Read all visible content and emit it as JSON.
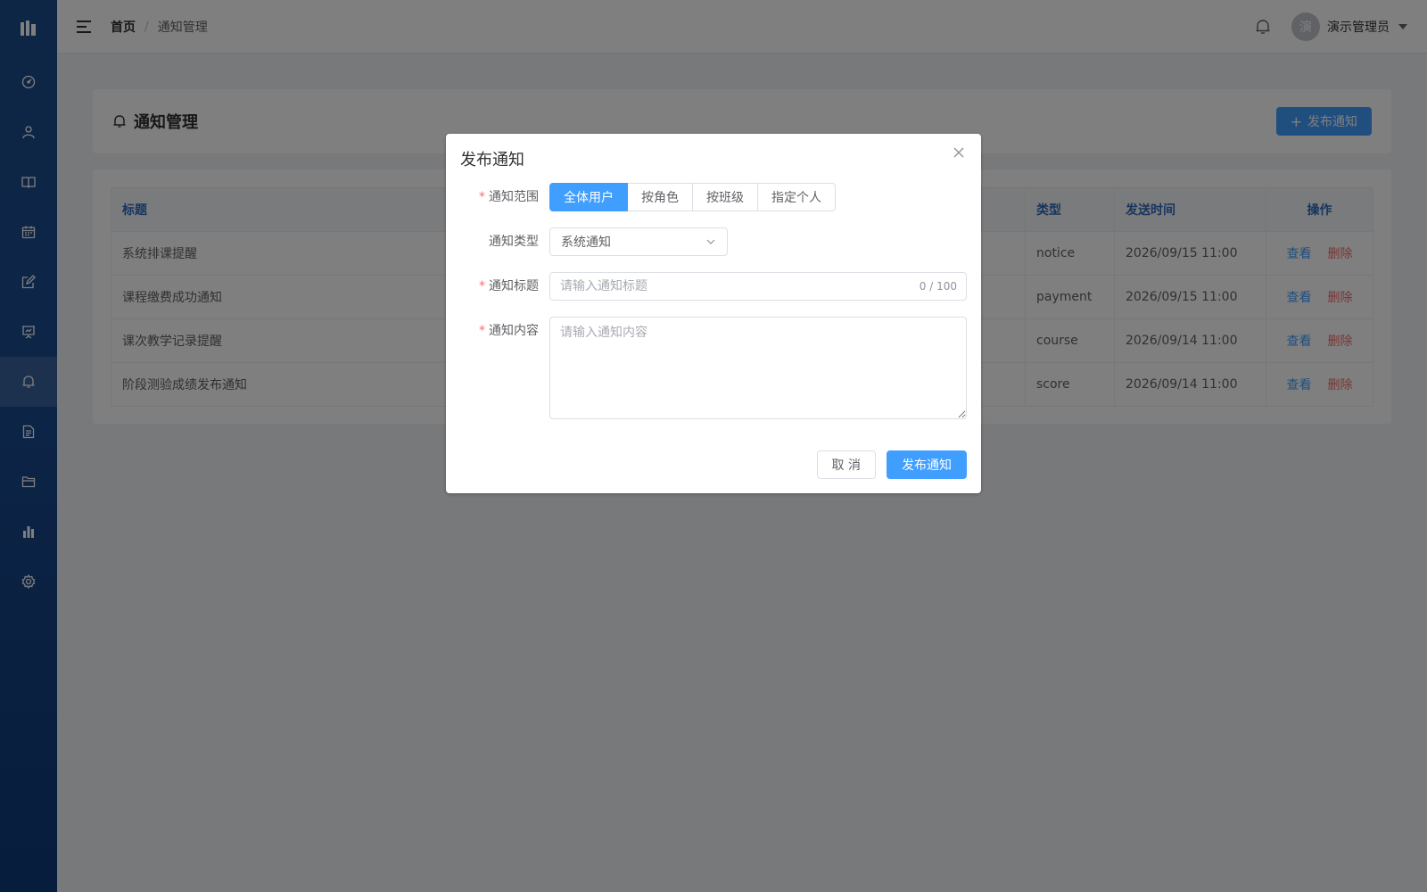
{
  "header": {
    "breadcrumb_home": "首页",
    "breadcrumb_sep": "/",
    "breadcrumb_current": "通知管理",
    "avatar_initial": "演",
    "username": "演示管理员"
  },
  "sidebar": {
    "items": [
      {
        "icon": "dashboard-icon"
      },
      {
        "icon": "user-icon"
      },
      {
        "icon": "book-icon"
      },
      {
        "icon": "calendar-icon"
      },
      {
        "icon": "edit-icon"
      },
      {
        "icon": "presentation-icon"
      },
      {
        "icon": "bell-icon",
        "active": true
      },
      {
        "icon": "document-icon"
      },
      {
        "icon": "folder-icon"
      },
      {
        "icon": "bar-chart-icon"
      },
      {
        "icon": "settings-icon"
      }
    ]
  },
  "page": {
    "title": "通知管理",
    "publish_label": "发布通知"
  },
  "table": {
    "headers": {
      "title": "标题",
      "type": "类型",
      "time": "发送时间",
      "ops": "操作"
    },
    "rows": [
      {
        "title": "系统排课提醒",
        "type": "notice",
        "time": "2026/09/15 11:00",
        "view": "查看",
        "delete": "删除"
      },
      {
        "title": "课程缴费成功通知",
        "type": "payment",
        "time": "2026/09/15 11:00",
        "view": "查看",
        "delete": "删除"
      },
      {
        "title": "课次教学记录提醒",
        "type": "course",
        "time": "2026/09/14 11:00",
        "view": "查看",
        "delete": "删除"
      },
      {
        "title": "阶段测验成绩发布通知",
        "type": "score",
        "time": "2026/09/14 11:00",
        "view": "查看",
        "delete": "删除"
      }
    ]
  },
  "dialog": {
    "title": "发布通知",
    "scope_label": "通知范围",
    "scope_options": [
      "全体用户",
      "按角色",
      "按班级",
      "指定个人"
    ],
    "scope_selected": "全体用户",
    "type_label": "通知类型",
    "type_value": "系统通知",
    "title_label": "通知标题",
    "title_placeholder": "请输入通知标题",
    "title_counter": "0 / 100",
    "content_label": "通知内容",
    "content_placeholder": "请输入通知内容",
    "required_mark": "*",
    "cancel_label": "取 消",
    "submit_label": "发布通知"
  },
  "colors": {
    "primary": "#409eff",
    "danger": "#f56c6c",
    "sidebar": "#1a4a8e"
  }
}
